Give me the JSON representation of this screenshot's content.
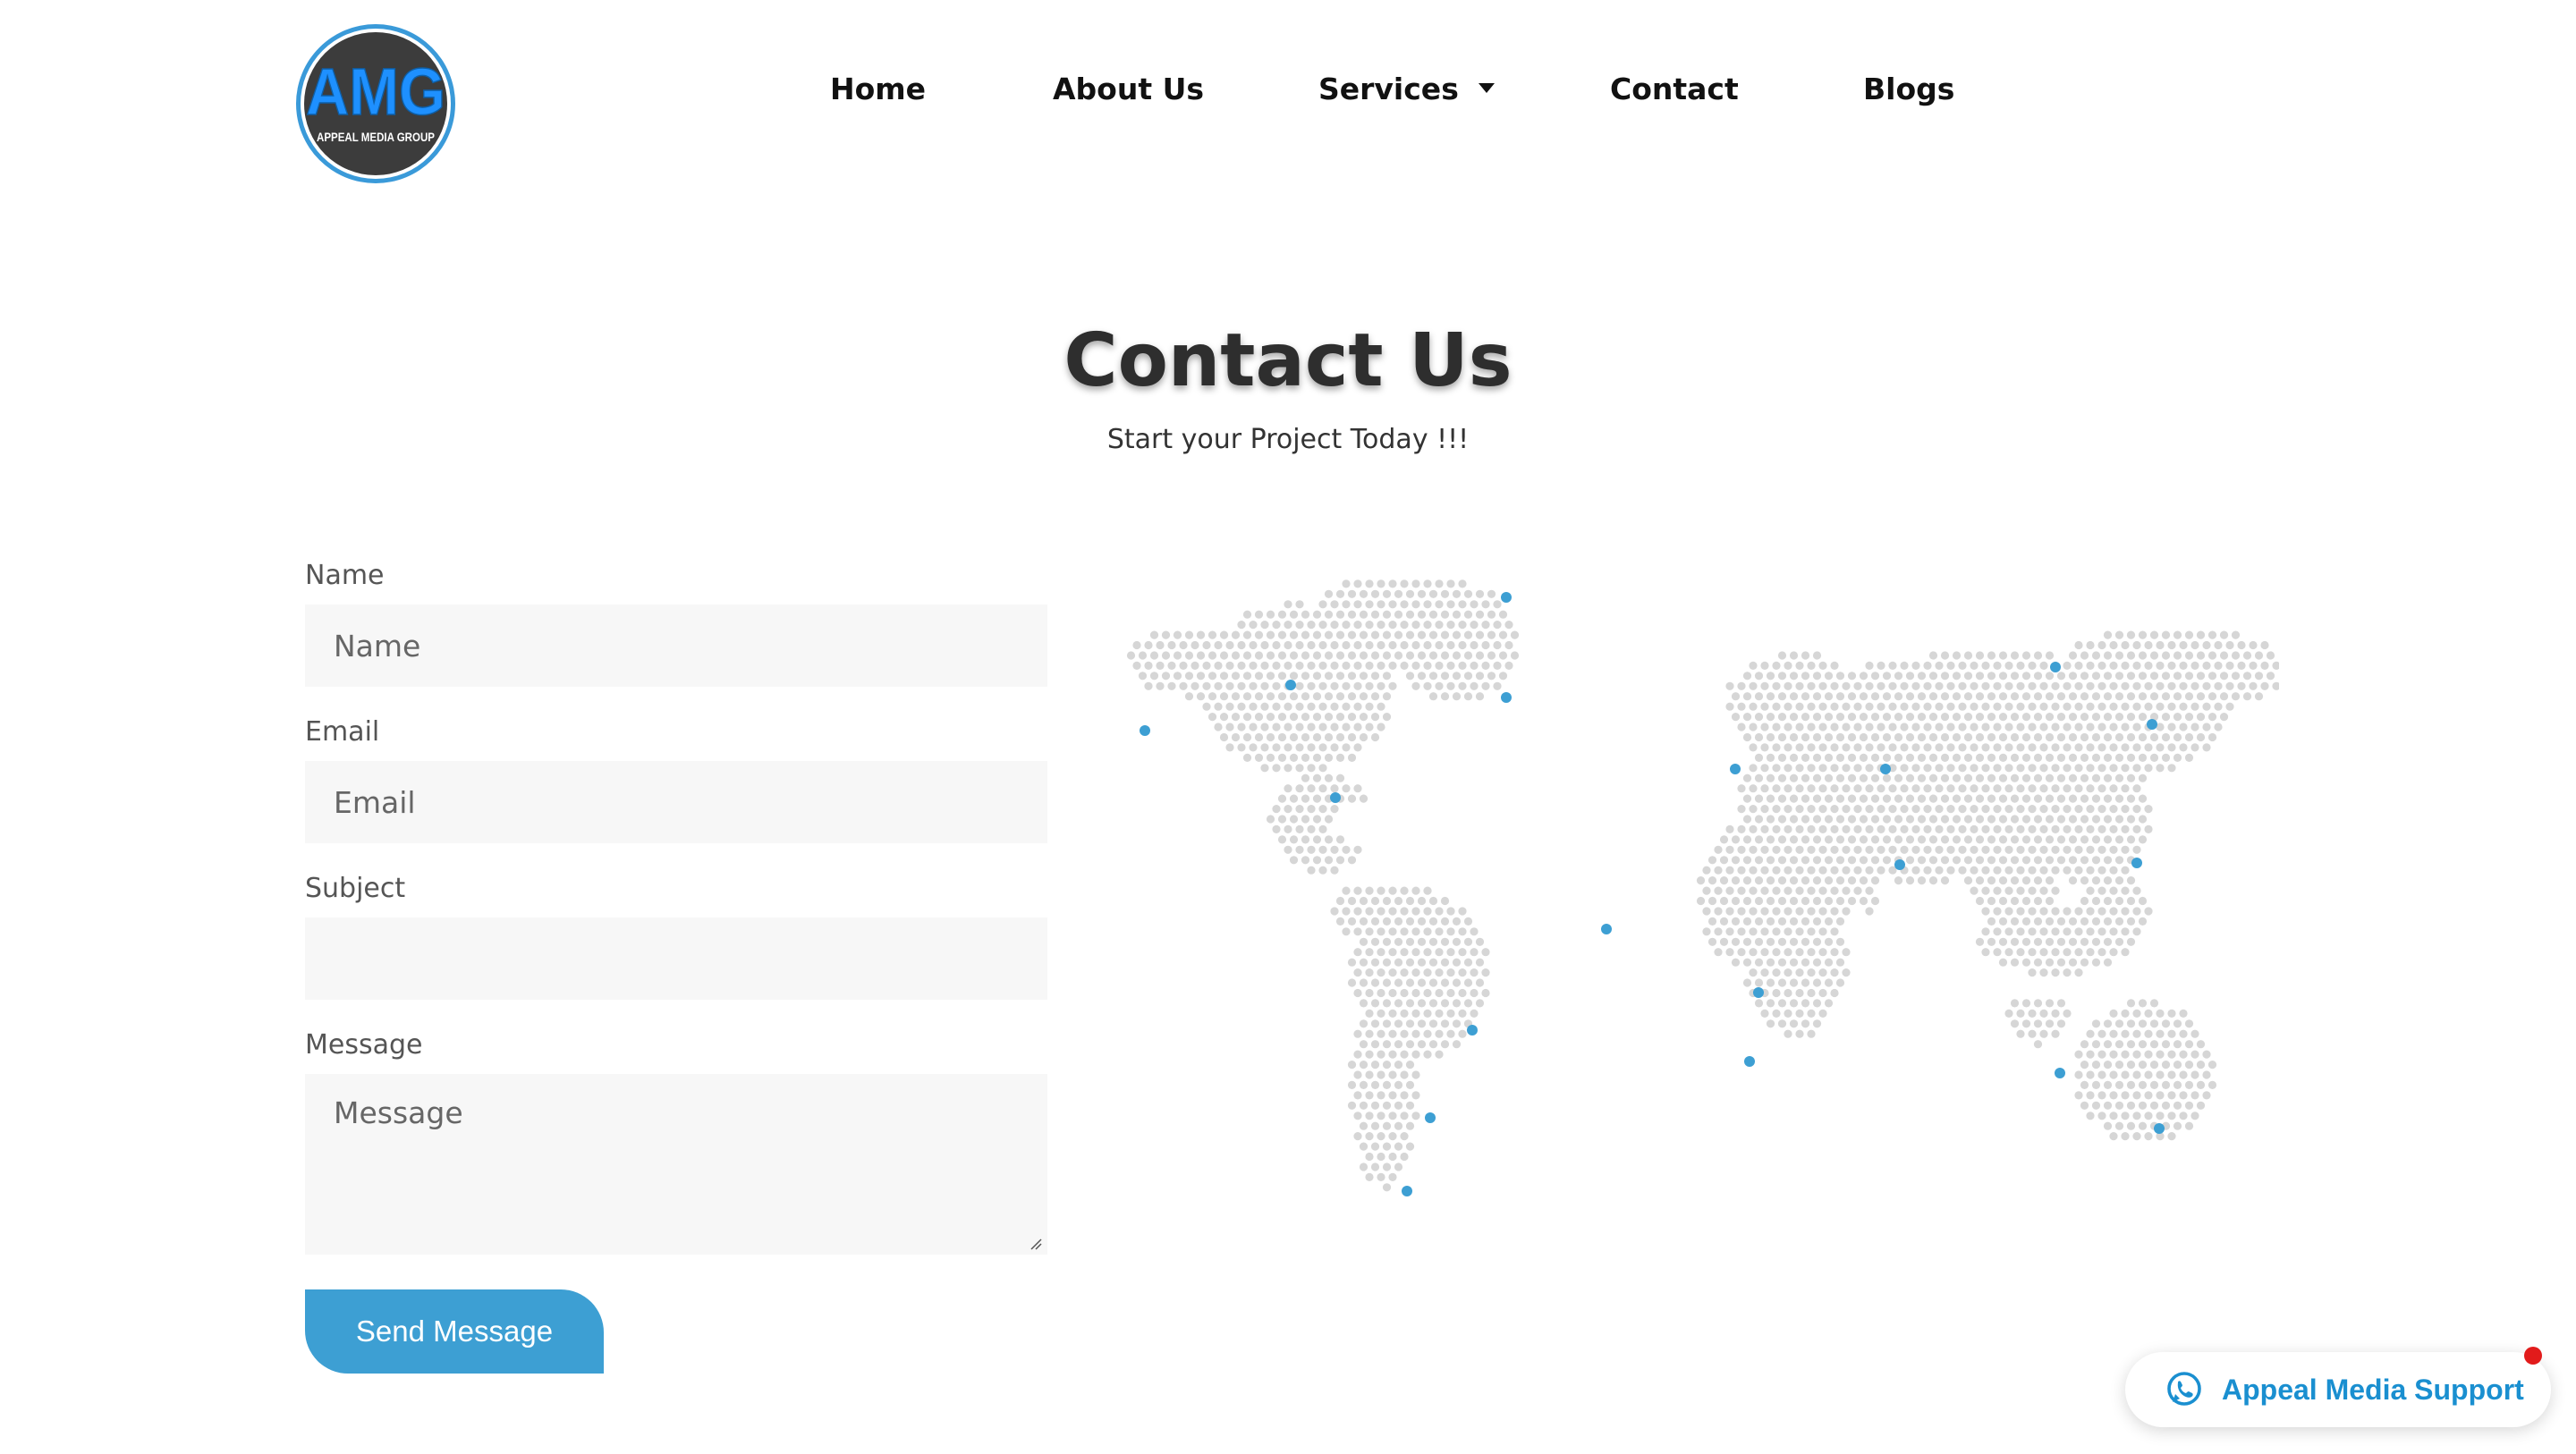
{
  "brand": {
    "logo_text": "AMG",
    "logo_subtext": "APPEAL MEDIA GROUP",
    "colors": {
      "ring": "#3a9ad9",
      "disc": "#3c3c3c",
      "letters": "#1e90ff"
    }
  },
  "nav": {
    "items": [
      {
        "label": "Home"
      },
      {
        "label": "About Us"
      },
      {
        "label": "Services",
        "has_dropdown": true
      },
      {
        "label": "Contact"
      },
      {
        "label": "Blogs"
      }
    ]
  },
  "hero": {
    "title": "Contact Us",
    "subtitle": "Start your Project Today !!!"
  },
  "form": {
    "name": {
      "label": "Name",
      "placeholder": "Name",
      "value": ""
    },
    "email": {
      "label": "Email",
      "placeholder": "Email",
      "value": ""
    },
    "subject": {
      "label": "Subject",
      "placeholder": "",
      "value": ""
    },
    "message": {
      "label": "Message",
      "placeholder": "Message",
      "value": ""
    },
    "submit_label": "Send Message",
    "colors": {
      "field_bg": "#f7f7f7",
      "button": "#3d9fd3"
    }
  },
  "map": {
    "icon": "world-dot-map",
    "colors": {
      "land_dots": "#d6d6d6",
      "markers": "#3d9fd3"
    }
  },
  "support_widget": {
    "label": "Appeal Media Support",
    "icon": "whatsapp-icon",
    "colors": {
      "text": "#1a8fd0",
      "notification": "#e21b1b"
    }
  }
}
